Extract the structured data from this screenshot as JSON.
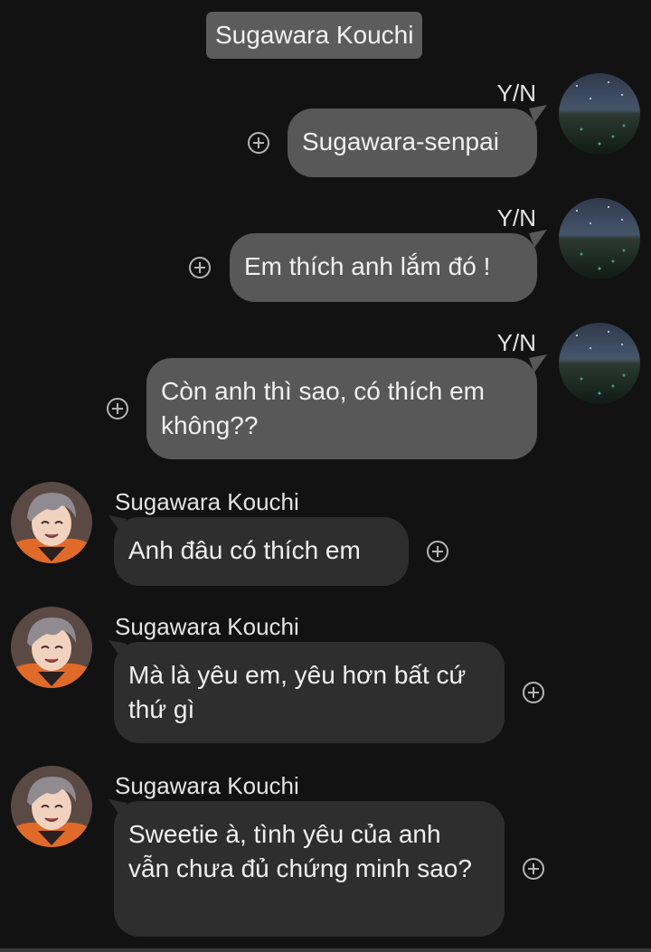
{
  "header": {
    "title": "Sugawara Kouchi"
  },
  "messages": [
    {
      "sender": "Y/N",
      "text": "Sugawara-senpai",
      "direction": "outgoing"
    },
    {
      "sender": "Y/N",
      "text": "Em thích anh lắm đó !",
      "direction": "outgoing"
    },
    {
      "sender": "Y/N",
      "text": "Còn anh thì sao, có thích em không??",
      "direction": "outgoing"
    },
    {
      "sender": "Sugawara Kouchi",
      "text": "Anh đâu có thích em",
      "direction": "incoming"
    },
    {
      "sender": "Sugawara Kouchi",
      "text": "Mà là yêu em, yêu hơn bất cứ thứ gì",
      "direction": "incoming"
    },
    {
      "sender": "Sugawara Kouchi",
      "text": "Sweetie à, tình yêu của anh vẫn chưa đủ chứng minh sao?",
      "direction": "incoming"
    }
  ],
  "colors": {
    "background": "#121212",
    "outgoing_bubble": "#585858",
    "incoming_bubble": "#2e2e2e",
    "header_pill": "#5c5c5c",
    "hair_gray": "#8f8b90",
    "jersey_orange": "#e06a2a"
  },
  "icons": {
    "add_reaction": "add-reaction-icon",
    "yn_avatar": "starry-field-avatar",
    "suga_avatar": "character-avatar"
  }
}
